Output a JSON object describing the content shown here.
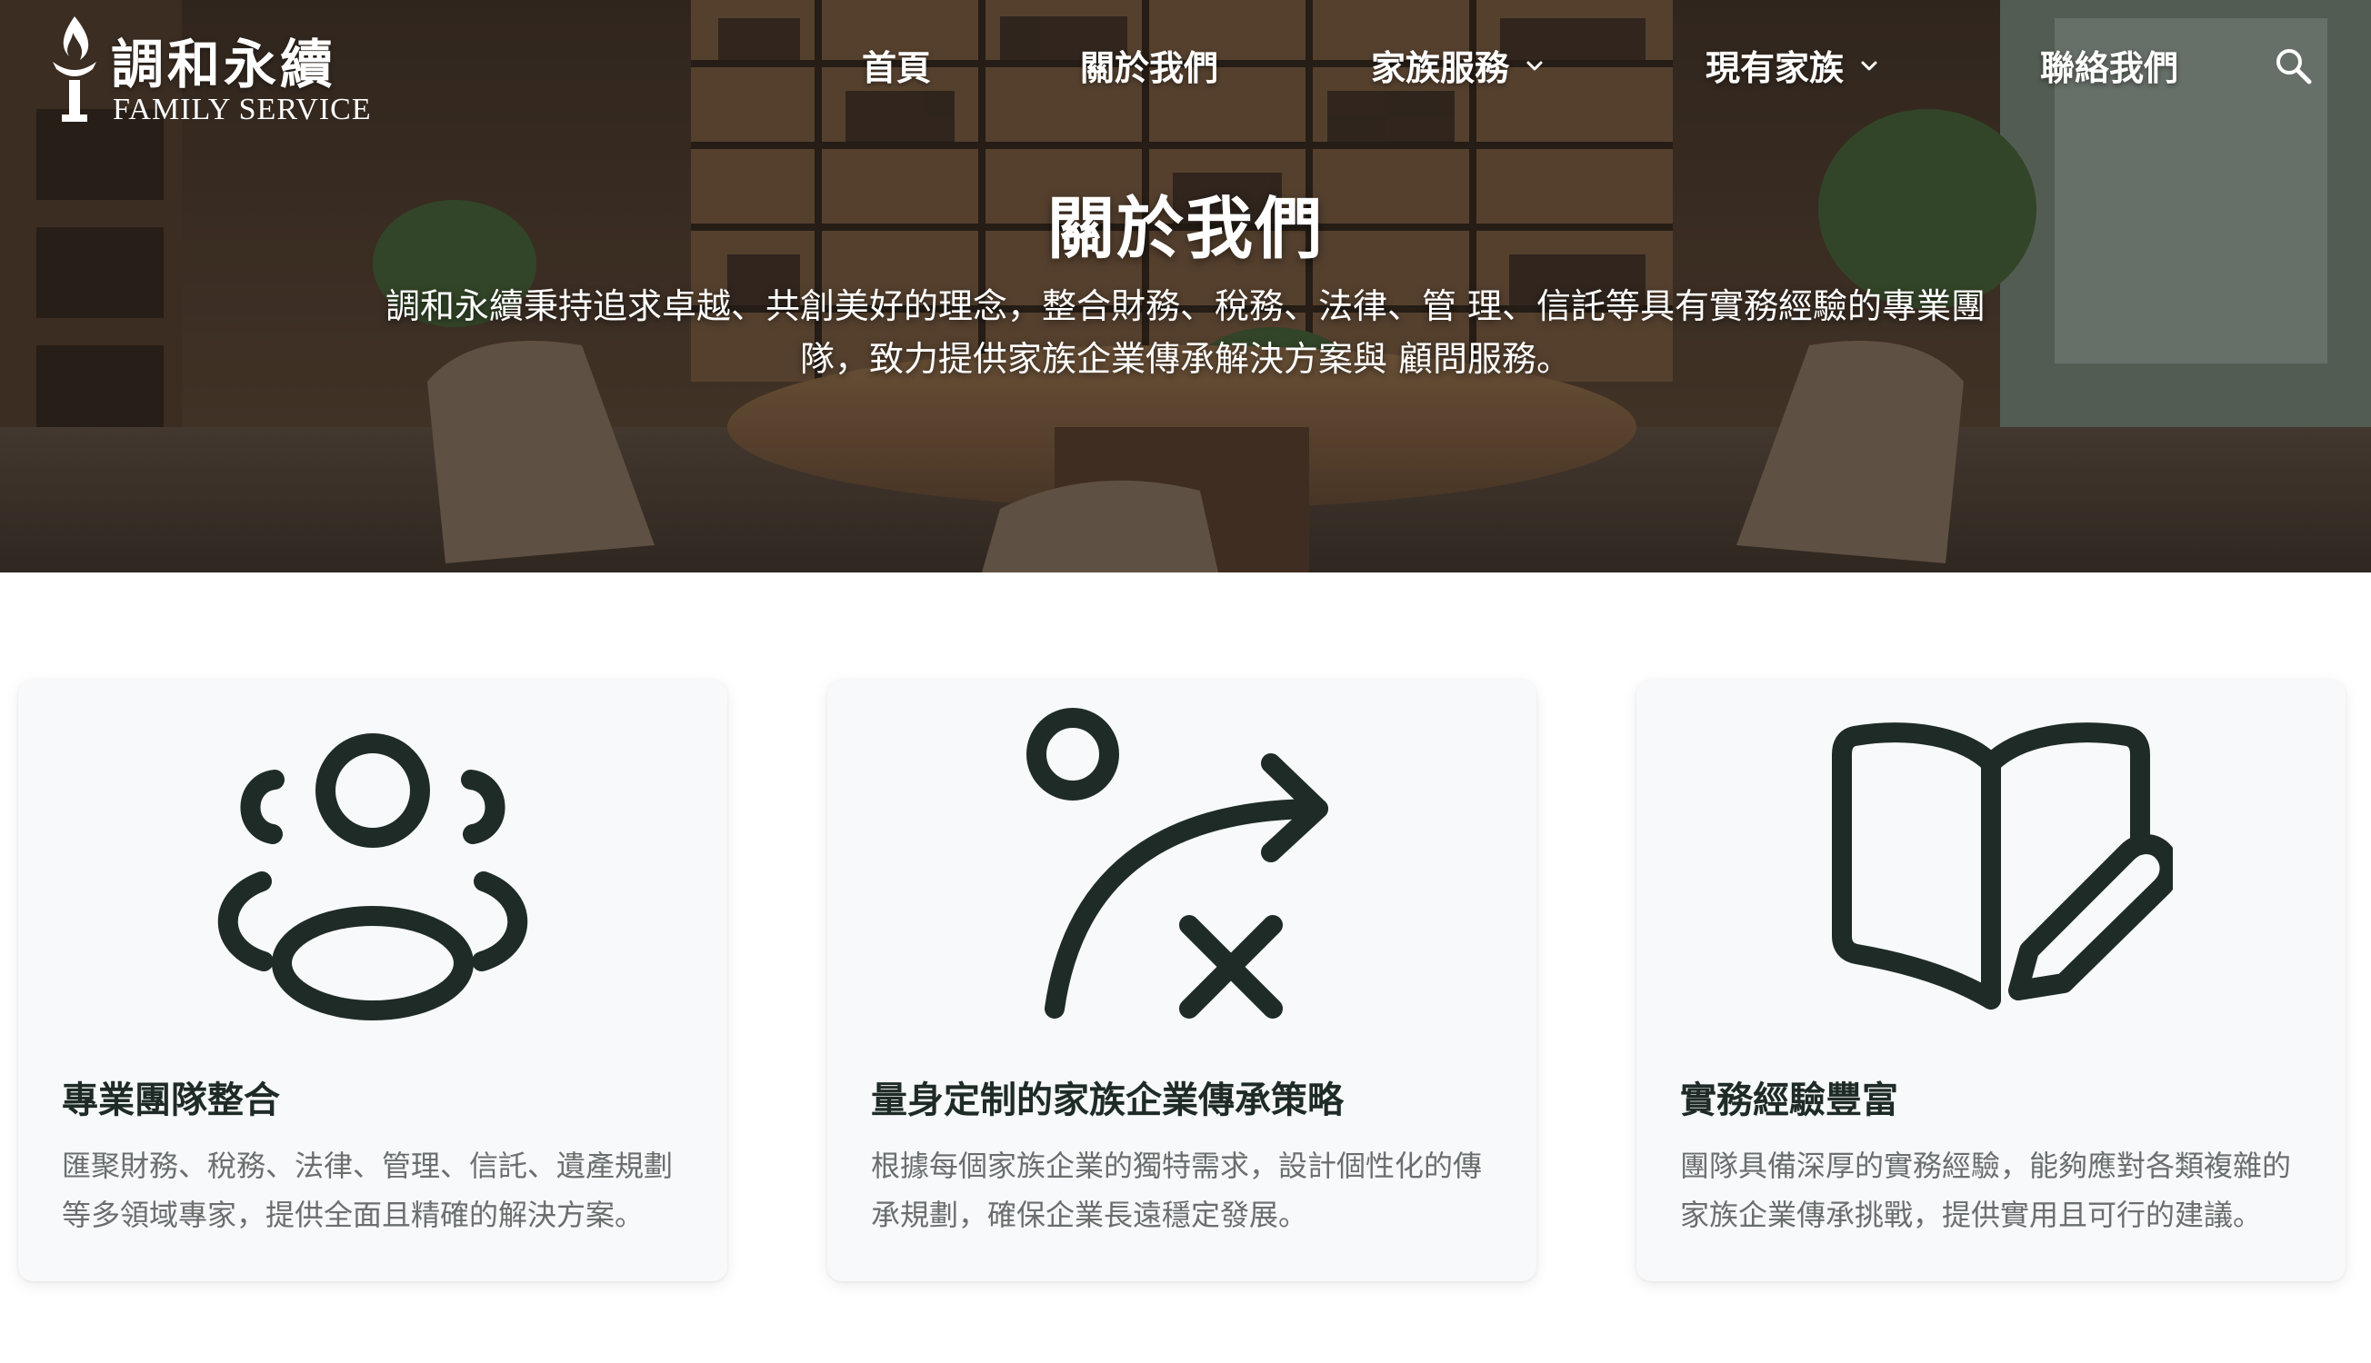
{
  "brand": {
    "name_cn": "調和永續",
    "name_en": "FAMILY SERVICE"
  },
  "nav": {
    "items": [
      {
        "label": "首頁",
        "has_dropdown": false
      },
      {
        "label": "關於我們",
        "has_dropdown": false
      },
      {
        "label": "家族服務",
        "has_dropdown": true
      },
      {
        "label": "現有家族",
        "has_dropdown": true
      },
      {
        "label": "聯絡我們",
        "has_dropdown": false
      }
    ],
    "search_icon": "search-icon"
  },
  "hero": {
    "title": "關於我們",
    "description": "調和永續秉持追求卓越、共創美好的理念，整合財務、稅務、法律、管 理、信託等具有實務經驗的專業團隊，致力提供家族企業傳承解決方案與 顧問服務。"
  },
  "features": [
    {
      "icon": "users-group-icon",
      "title": "專業團隊整合",
      "description": "匯聚財務、稅務、法律、管理、信託、遺產規劃等多領域專家，提供全面且精確的解決方案。"
    },
    {
      "icon": "strategy-route-icon",
      "title": "量身定制的家族企業傳承策略",
      "description": "根據每個家族企業的獨特需求，設計個性化的傳承規劃，確保企業長遠穩定發展。"
    },
    {
      "icon": "book-edit-icon",
      "title": "實務經驗豐富",
      "description": "團隊具備深厚的實務經驗，能夠應對各類複雜的家族企業傳承挑戰，提供實用且可行的建議。"
    }
  ],
  "colors": {
    "icon_stroke": "#1f2b26",
    "card_bg": "#f7f9fa",
    "body_text": "#6a6f6d"
  }
}
